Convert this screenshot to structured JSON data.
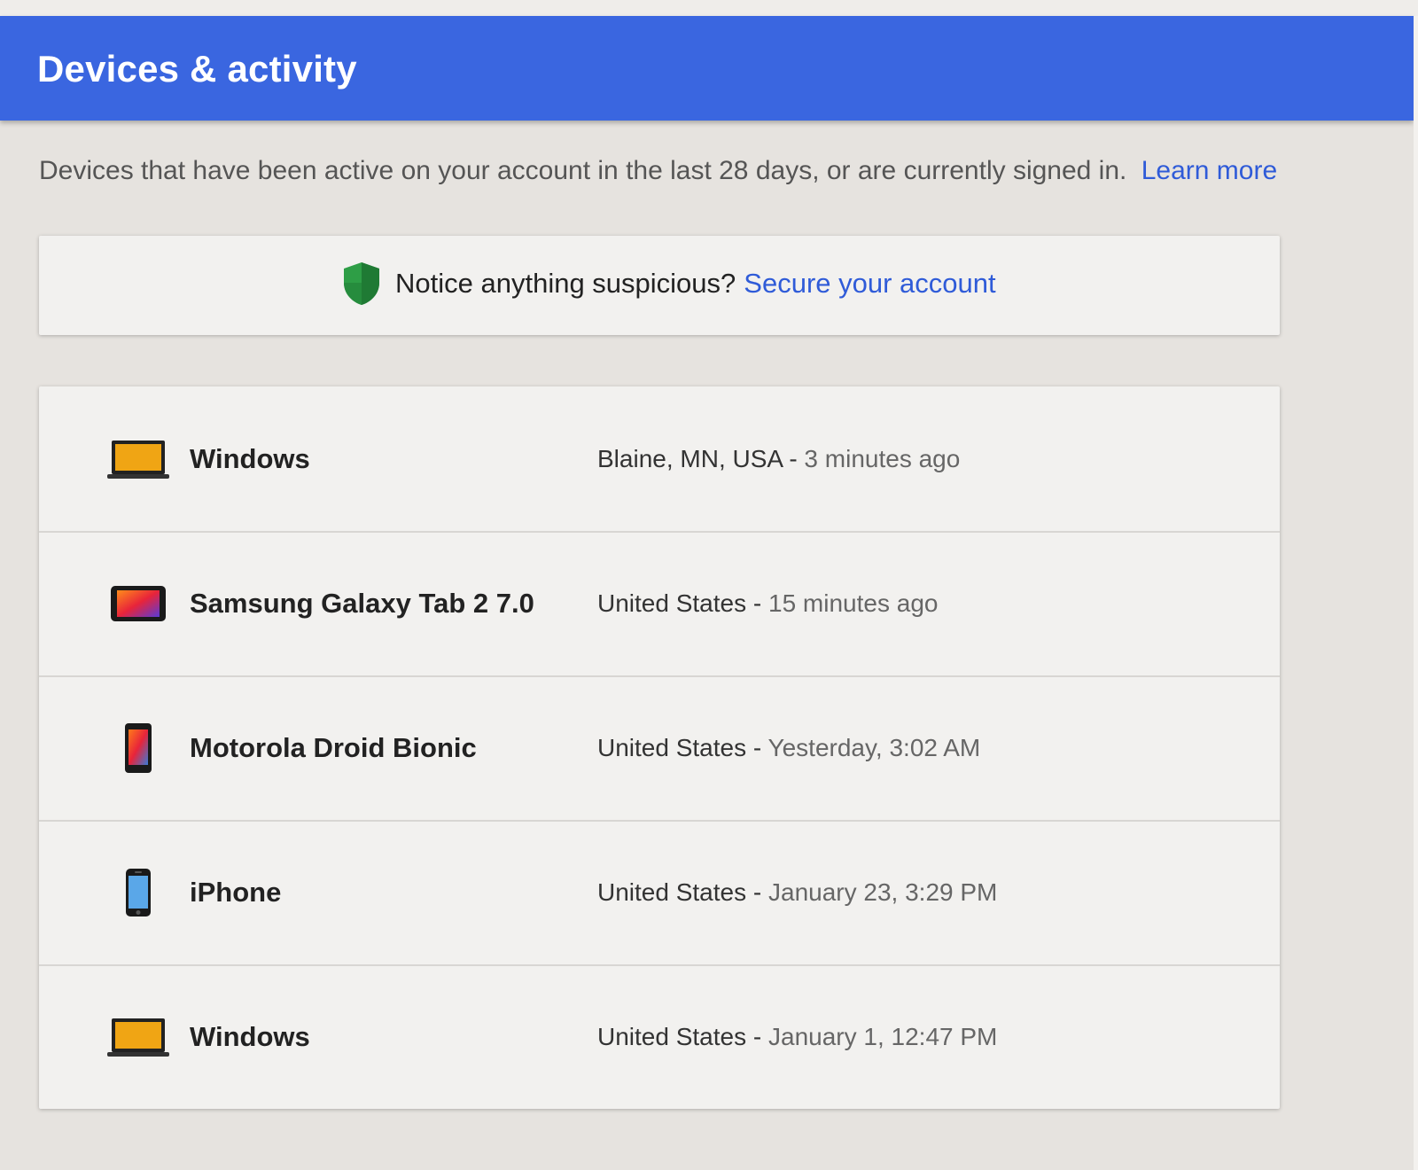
{
  "header": {
    "title": "Devices & activity"
  },
  "intro": {
    "text": "Devices that have been active on your account in the last 28 days, or are currently signed in.",
    "learn_more": "Learn more"
  },
  "notice": {
    "icon": "shield-icon",
    "text": "Notice anything suspicious?",
    "link": "Secure your account",
    "shield_colors": [
      "#2e9e46",
      "#1f7a34"
    ]
  },
  "colors": {
    "header_bg": "#3a66e0",
    "link": "#2f5bd8",
    "page_bg": "#e6e3df",
    "card_bg": "#f2f1ef"
  },
  "devices": [
    {
      "icon": "laptop-icon",
      "name": "Windows",
      "location": "Blaine, MN, USA",
      "separator": "-",
      "time": "3 minutes ago"
    },
    {
      "icon": "tablet-icon",
      "name": "Samsung Galaxy Tab 2 7.0",
      "location": "United States",
      "separator": "-",
      "time": "15 minutes ago"
    },
    {
      "icon": "android-phone-icon",
      "name": "Motorola Droid Bionic",
      "location": "United States",
      "separator": "-",
      "time": "Yesterday, 3:02 AM"
    },
    {
      "icon": "iphone-icon",
      "name": "iPhone",
      "location": "United States",
      "separator": "-",
      "time": "January 23, 3:29 PM"
    },
    {
      "icon": "laptop-icon",
      "name": "Windows",
      "location": "United States",
      "separator": "-",
      "time": "January 1, 12:47 PM"
    }
  ]
}
